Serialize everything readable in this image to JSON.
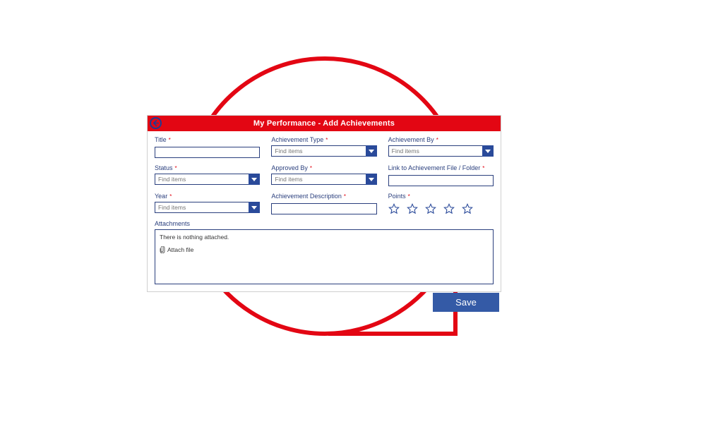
{
  "header": {
    "title": "My Performance - Add Achievements"
  },
  "fields": {
    "title_label": "Title",
    "title_value": "",
    "ach_type_label": "Achievement Type",
    "ach_type_placeholder": "Find items",
    "ach_by_label": "Achievement By",
    "ach_by_placeholder": "Find items",
    "status_label": "Status",
    "status_placeholder": "Find items",
    "approved_by_label": "Approved By",
    "approved_by_placeholder": "Find items",
    "link_label": "Link to Achievement File / Folder",
    "link_value": "",
    "year_label": "Year",
    "year_placeholder": "Find items",
    "ach_desc_label": "Achievement Description",
    "ach_desc_value": "",
    "points_label": "Points"
  },
  "attachments": {
    "title": "Attachments",
    "empty_text": "There is nothing attached.",
    "attach_link": "Attach file"
  },
  "actions": {
    "save": "Save"
  },
  "colors": {
    "header_bg": "#e30613",
    "primary_blue": "#2a4a9a",
    "border_blue": "#2a3f7d"
  }
}
